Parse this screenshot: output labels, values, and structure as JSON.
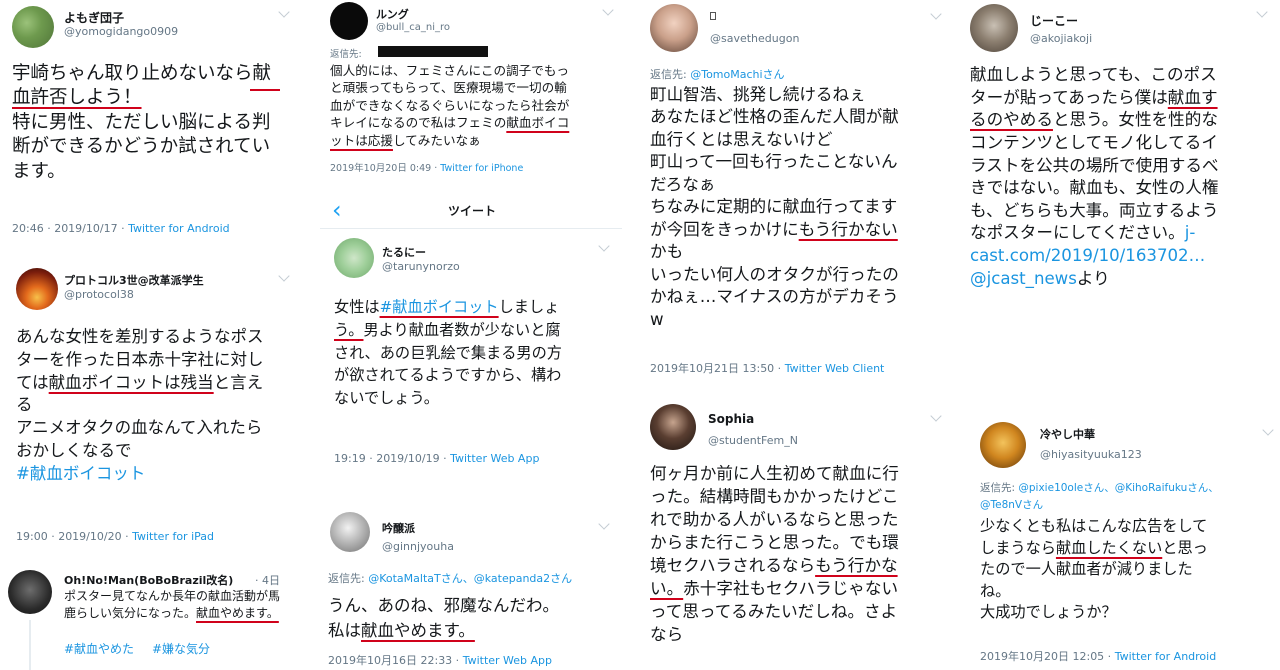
{
  "col1": {
    "t1": {
      "name": "よもぎ団子",
      "handle": "@yomogidango0909",
      "lines": [
        "宇崎ちゃん取り止めないなら献",
        "血許否しよう！",
        "特に男性、ただしい脳による判",
        "断ができるかどうか試されてい",
        "ます。"
      ],
      "ul1a": "献",
      "ul1b": "血許否しよう！",
      "time": "20:46 · 2019/10/17 · ",
      "source": "Twitter for Android"
    },
    "t2": {
      "name": "プロトコル3世@改革派学生",
      "handle": "@protocol38",
      "l1": "あんな女性を差別するようなポス",
      "l2": "ターを作った日本赤十字社に対し",
      "l3a": "ては",
      "l3u": "献血ボイコットは残当",
      "l3b": "と言え",
      "l4": "る",
      "l5": "アニメオタクの血なんて入れたら",
      "l6": "おかしくなるで",
      "tag": "#献血ボイコット",
      "time": "19:00 · 2019/10/20 · ",
      "source": "Twitter for iPad"
    },
    "t3": {
      "name": "Oh!No!Man(BoBoBrazil改名)",
      "date": "· 4日",
      "l1": "ポスター見てなんか長年の献血活動が馬",
      "l2a": "鹿らしい気分になった。",
      "l2u": "献血やめます。",
      "tag1": "#献血やめた",
      "tag2": "#嫌な気分"
    }
  },
  "col2": {
    "t1": {
      "name": "ルング",
      "handle": "@bull_ca_ni_ro",
      "reply": "返信先:",
      "l1": "個人的には、フェミさんにこの調子でもっ",
      "l2": "と頑張ってもらって、医療現場で一切の輸",
      "l3": "血ができなくなるぐらいになったら社会が",
      "l4a": "キレイになるので私はフェミの",
      "l4u": "献血ボイコ",
      "l5u": "ットは応援",
      "l5b": "してみたいなぁ",
      "time": "2019年10月20日 0:49 · ",
      "source": "Twitter for iPhone"
    },
    "nav": {
      "title": "ツイート",
      "back": "‹"
    },
    "t2": {
      "name": "たるにー",
      "handle": "@tarunynorzo",
      "l1a": "女性は",
      "l1t": "#献血ボイコット",
      "l1b": "しましょ",
      "l2u": "う。",
      "l2b": "男より献血者数が少ないと腐",
      "l3": "され、あの巨乳絵で集まる男の方",
      "l4": "が欲されてるようですから、構わ",
      "l5": "ないでしょう。",
      "time": "19:19 · 2019/10/19 · ",
      "source": "Twitter Web App"
    },
    "t3": {
      "name": "吟醸派",
      "handle": "@ginnjyouha",
      "reply": "返信先:",
      "m1": "@KotaMaltaTさん、@katepanda2さん",
      "l1": "うん、あのね、邪魔なんだわ。",
      "l2a": "私は",
      "l2u": "献血やめます。",
      "time": "2019年10月16日 22:33 · ",
      "source": "Twitter Web App"
    }
  },
  "col3": {
    "t1": {
      "name": "",
      "handle": "@savethedugon",
      "reply": "返信先:",
      "m1": "@TomoMachiさん",
      "l1": "町山智浩、挑発し続けるねぇ",
      "l2": "あなたほど性格の歪んだ人間が献",
      "l3": "血行くとは思えないけど",
      "l4": "町山って一回も行ったことないん",
      "l5": "だろなぁ",
      "l6": "ちなみに定期的に献血行ってます",
      "l7a": "が今回をきっかけに",
      "l7u": "もう行かない",
      "l8": "かも",
      "l9": "いったい何人のオタクが行ったの",
      "l10": "かねぇ…マイナスの方がデカそう",
      "l11": "w",
      "time": "2019年10月21日 13:50 · ",
      "source": "Twitter Web Client"
    },
    "t2": {
      "name": "Sophia",
      "handle": "@studentFem_N",
      "l1": "何ヶ月か前に人生初めて献血に行",
      "l2": "った。結構時間もかかったけどこ",
      "l3": "れで助かる人がいるならと思った",
      "l4": "からまた行こうと思った。でも環",
      "l5a": "境セクハラされるなら",
      "l5u": "もう行かな",
      "l6u": "い。",
      "l6b": "赤十字社もセクハラじゃない",
      "l7": "って思ってるみたいだしね。さよ",
      "l8": "なら"
    }
  },
  "col4": {
    "t1": {
      "name": "じーこー",
      "handle": "@akojiakoji",
      "l1": "献血しようと思っても、このポス",
      "l2a": "ターが貼ってあったら僕は",
      "l2u": "献血す",
      "l3u": "るのやめる",
      "l3b": "と思う。女性を性的な",
      "l4": "コンテンツとしてモノ化してるイ",
      "l5": "ラストを公共の場所で使用するべ",
      "l6": "きではない。献血も、女性の人権",
      "l7": "も、どちらも大事。両立するよう",
      "l8a": "なポスターにしてください。",
      "l8t": "j-",
      "l9t": "cast.com/2019/10/163702…",
      "l10t": "@jcast_news",
      "l10b": "より"
    },
    "t2": {
      "name": "冷やし中華",
      "handle": "@hiyasityuuka123",
      "reply": "返信先:",
      "m1": "@pixie10oleさん、@KihoRaifukuさん、",
      "m2": "@Te8nVさん",
      "l1": "少なくとも私はこんな広告をして",
      "l2a": "しまうなら",
      "l2u": "献血したくない",
      "l2b": "と思っ",
      "l3": "たので一人献血者が減りました",
      "l4": "ね。",
      "l5": "大成功でしょうか？",
      "time": "2019年10月20日 12:05 · ",
      "source": "Twitter for Android"
    }
  },
  "colors": {
    "accent": "#1b95e0",
    "underline": "#d0021b",
    "muted": "#657786"
  }
}
